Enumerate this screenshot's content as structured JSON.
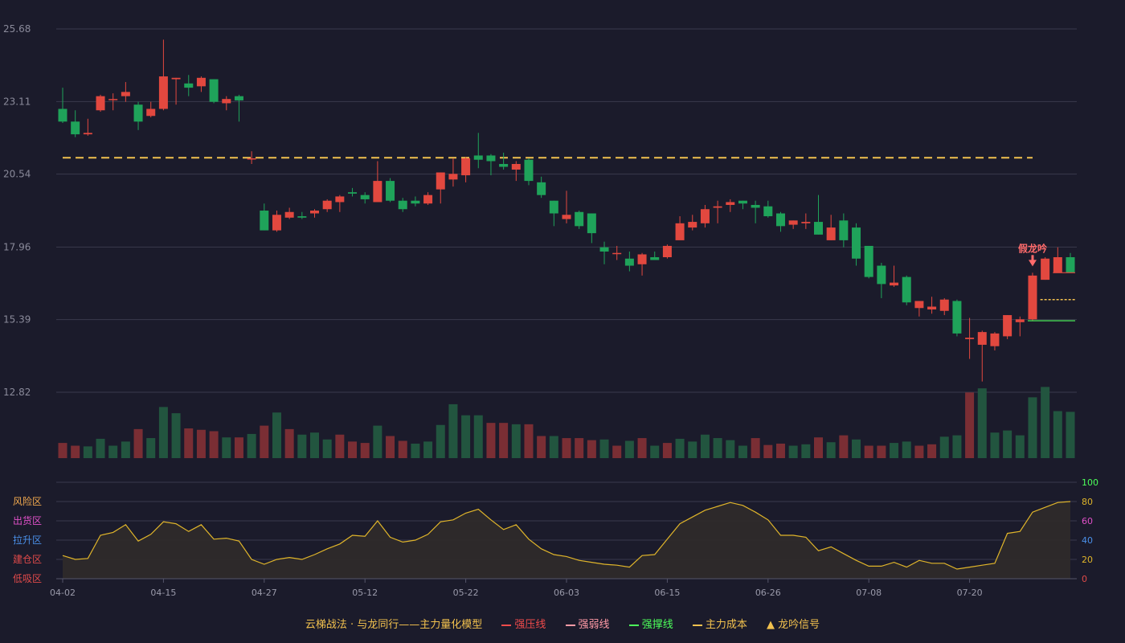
{
  "chart_data": {
    "type": "candlestick",
    "price_axis": {
      "ticks": [
        12.82,
        15.39,
        17.96,
        20.54,
        23.11,
        25.68
      ],
      "ylim": [
        12.82,
        25.68
      ]
    },
    "dates": [
      "04-02",
      "04-03",
      "04-07",
      "04-08",
      "04-09",
      "04-10",
      "04-11",
      "04-14",
      "04-15",
      "04-16",
      "04-17",
      "04-18",
      "04-21",
      "04-22",
      "04-23",
      "04-24",
      "04-25",
      "04-28",
      "04-29",
      "04-30",
      "05-06",
      "05-07",
      "05-08",
      "05-09",
      "05-12",
      "05-13",
      "05-14",
      "05-15",
      "05-16",
      "05-19",
      "05-20",
      "05-21",
      "05-22",
      "05-23",
      "05-26",
      "05-27",
      "05-28",
      "05-29",
      "05-30",
      "06-03",
      "06-04",
      "06-05",
      "06-06",
      "06-09",
      "06-10",
      "06-11",
      "06-12",
      "06-13",
      "06-16",
      "06-17",
      "06-18",
      "06-19",
      "06-20",
      "06-23",
      "06-24",
      "06-25",
      "06-26",
      "06-27",
      "06-30",
      "07-01",
      "07-02",
      "07-03",
      "07-04",
      "07-07",
      "07-08",
      "07-09",
      "07-10",
      "07-11",
      "07-14",
      "07-15",
      "07-16",
      "07-17",
      "07-18",
      "07-21",
      "07-22",
      "07-23",
      "07-24",
      "07-25",
      "07-28",
      "07-29",
      "07-30"
    ],
    "x_ticks": [
      "04-02",
      "04-15",
      "04-27",
      "05-12",
      "05-22",
      "06-03",
      "06-15",
      "06-26",
      "07-08",
      "07-20"
    ],
    "x_tick_index": [
      0,
      8,
      16,
      24,
      32,
      40,
      48,
      56,
      64,
      72
    ],
    "ohlc": [
      [
        22.85,
        22.4,
        23.6,
        22.35
      ],
      [
        22.4,
        21.95,
        22.8,
        21.85
      ],
      [
        21.95,
        22.0,
        22.5,
        21.9
      ],
      [
        22.8,
        23.3,
        23.35,
        22.75
      ],
      [
        23.2,
        23.2,
        23.4,
        22.8
      ],
      [
        23.3,
        23.45,
        23.8,
        23.1
      ],
      [
        23.0,
        22.4,
        23.1,
        22.1
      ],
      [
        22.6,
        22.85,
        23.1,
        22.55
      ],
      [
        22.85,
        24.0,
        25.3,
        22.8
      ],
      [
        23.9,
        23.95,
        23.95,
        23.0
      ],
      [
        23.75,
        23.6,
        24.05,
        23.3
      ],
      [
        23.65,
        23.95,
        24.0,
        23.45
      ],
      [
        23.9,
        23.1,
        23.9,
        23.05
      ],
      [
        23.05,
        23.2,
        23.3,
        22.8
      ],
      [
        23.3,
        23.15,
        23.35,
        22.4
      ],
      [
        21.1,
        21.1,
        21.35,
        20.9
      ],
      [
        19.25,
        18.55,
        19.5,
        18.55
      ],
      [
        18.55,
        19.1,
        19.25,
        18.5
      ],
      [
        19.0,
        19.2,
        19.35,
        18.95
      ],
      [
        19.05,
        19.0,
        19.2,
        18.95
      ],
      [
        19.15,
        19.25,
        19.3,
        19.0
      ],
      [
        19.3,
        19.6,
        19.65,
        19.2
      ],
      [
        19.55,
        19.75,
        19.8,
        19.2
      ],
      [
        19.9,
        19.85,
        20.05,
        19.75
      ],
      [
        19.8,
        19.65,
        19.9,
        19.5
      ],
      [
        19.55,
        20.3,
        21.0,
        19.6
      ],
      [
        20.3,
        19.6,
        20.4,
        19.55
      ],
      [
        19.6,
        19.3,
        19.7,
        19.2
      ],
      [
        19.6,
        19.5,
        19.75,
        19.4
      ],
      [
        19.5,
        19.8,
        19.9,
        19.45
      ],
      [
        20.0,
        20.6,
        20.6,
        19.5
      ],
      [
        20.35,
        20.55,
        21.1,
        20.1
      ],
      [
        20.5,
        21.1,
        21.15,
        20.25
      ],
      [
        21.2,
        21.05,
        22.0,
        20.75
      ],
      [
        21.2,
        21.0,
        21.25,
        20.5
      ],
      [
        20.9,
        20.8,
        21.3,
        20.7
      ],
      [
        20.7,
        20.9,
        21.0,
        20.3
      ],
      [
        21.05,
        20.3,
        21.1,
        20.15
      ],
      [
        20.25,
        19.8,
        20.45,
        19.7
      ],
      [
        19.6,
        19.15,
        19.6,
        18.7
      ],
      [
        18.95,
        19.1,
        19.95,
        18.8
      ],
      [
        19.2,
        18.7,
        19.25,
        18.6
      ],
      [
        19.15,
        18.45,
        19.15,
        18.1
      ],
      [
        17.95,
        17.8,
        18.15,
        17.35
      ],
      [
        17.75,
        17.75,
        18.0,
        17.5
      ],
      [
        17.55,
        17.3,
        17.8,
        17.1
      ],
      [
        17.35,
        17.7,
        17.75,
        16.95
      ],
      [
        17.6,
        17.5,
        17.8,
        17.55
      ],
      [
        17.6,
        18.0,
        18.05,
        17.55
      ],
      [
        18.2,
        18.8,
        19.05,
        18.25
      ],
      [
        18.65,
        18.85,
        19.1,
        18.55
      ],
      [
        18.8,
        19.3,
        19.45,
        18.65
      ],
      [
        19.35,
        19.4,
        19.6,
        18.8
      ],
      [
        19.45,
        19.55,
        19.65,
        19.2
      ],
      [
        19.6,
        19.5,
        19.6,
        19.3
      ],
      [
        19.45,
        19.35,
        19.6,
        18.8
      ],
      [
        19.4,
        19.05,
        19.6,
        19.0
      ],
      [
        19.15,
        18.7,
        19.2,
        18.5
      ],
      [
        18.75,
        18.9,
        18.9,
        18.6
      ],
      [
        18.8,
        18.85,
        19.15,
        18.6
      ],
      [
        18.85,
        18.4,
        19.8,
        18.4
      ],
      [
        18.2,
        18.65,
        19.1,
        18.2
      ],
      [
        18.9,
        18.2,
        19.15,
        17.95
      ],
      [
        18.65,
        17.55,
        18.8,
        17.3
      ],
      [
        18.0,
        16.9,
        18.0,
        16.85
      ],
      [
        17.3,
        16.65,
        17.4,
        16.15
      ],
      [
        16.6,
        16.7,
        17.3,
        16.55
      ],
      [
        16.9,
        16.0,
        16.95,
        15.9
      ],
      [
        15.8,
        16.05,
        16.05,
        15.5
      ],
      [
        15.75,
        15.85,
        16.2,
        15.6
      ],
      [
        15.7,
        16.1,
        16.15,
        15.55
      ],
      [
        16.05,
        14.9,
        16.1,
        14.8
      ],
      [
        14.7,
        14.75,
        15.45,
        14.0
      ],
      [
        14.5,
        14.95,
        15.0,
        13.2
      ],
      [
        14.45,
        14.9,
        14.95,
        14.3
      ],
      [
        14.8,
        15.55,
        15.55,
        14.7
      ],
      [
        15.3,
        15.4,
        15.5,
        14.8
      ],
      [
        15.4,
        16.95,
        17.05,
        15.35
      ],
      [
        16.8,
        17.55,
        17.6,
        16.8
      ],
      [
        17.05,
        17.6,
        17.95,
        17.05
      ],
      [
        17.6,
        17.05,
        17.75,
        17.05
      ]
    ],
    "volume_axis": {
      "ticks": [
        100
      ]
    },
    "volume": [
      22,
      18,
      17,
      28,
      18,
      24,
      42,
      29,
      74,
      65,
      43,
      41,
      39,
      30,
      30,
      35,
      47,
      66,
      42,
      34,
      37,
      27,
      34,
      24,
      22,
      47,
      32,
      25,
      21,
      24,
      48,
      78,
      62,
      62,
      51,
      51,
      49,
      49,
      32,
      32,
      29,
      29,
      26,
      27,
      18,
      25,
      29,
      18,
      22,
      28,
      24,
      34,
      29,
      26,
      18,
      29,
      19,
      21,
      18,
      20,
      30,
      23,
      33,
      27,
      18,
      18,
      22,
      24,
      18,
      20,
      31,
      33,
      95,
      101,
      37,
      40,
      33,
      88,
      103,
      68,
      67
    ],
    "volume_colors": [
      "red",
      "red",
      "green",
      "green",
      "green",
      "green",
      "red",
      "green",
      "green",
      "green",
      "red",
      "red",
      "red",
      "green",
      "red",
      "green",
      "red",
      "green",
      "red",
      "green",
      "green",
      "green",
      "red",
      "red",
      "red",
      "green",
      "red",
      "red",
      "green",
      "green",
      "green",
      "green",
      "green",
      "green",
      "red",
      "red",
      "green",
      "red",
      "red",
      "green",
      "red",
      "red",
      "red",
      "green",
      "red",
      "green",
      "red",
      "green",
      "red",
      "green",
      "green",
      "green",
      "green",
      "green",
      "green",
      "red",
      "red",
      "red",
      "green",
      "green",
      "red",
      "green",
      "red",
      "green",
      "red",
      "red",
      "green",
      "green",
      "red",
      "red",
      "green",
      "green",
      "red",
      "green",
      "green",
      "green",
      "green",
      "green",
      "green",
      "green",
      "green"
    ],
    "indicator_axis": {
      "ticks": [
        0,
        20,
        40,
        60,
        80,
        100
      ],
      "ylim": [
        0,
        100
      ]
    },
    "indicator": [
      24,
      20,
      21,
      45,
      48,
      56,
      39,
      46,
      59,
      57,
      49,
      56,
      41,
      42,
      39,
      20,
      15,
      20,
      22,
      20,
      25,
      31,
      36,
      45,
      44,
      60,
      43,
      38,
      40,
      46,
      59,
      61,
      68,
      72,
      61,
      51,
      56,
      41,
      31,
      25,
      23,
      19,
      17,
      15,
      14,
      12,
      24,
      25,
      41,
      57,
      64,
      71,
      75,
      79,
      76,
      69,
      61,
      45,
      45,
      43,
      29,
      33,
      26,
      19,
      13,
      13,
      17,
      12,
      19,
      16,
      16,
      10,
      12,
      14,
      16,
      47,
      49,
      69,
      74,
      79,
      80
    ],
    "signal": {
      "label": "假龙吟",
      "index": 77
    },
    "lines": {
      "main_cost_dashed": 21.12,
      "main_cost_short": 16.1,
      "strong_support": 15.35,
      "strong_pressure": 17.05
    },
    "zones": [
      "风险区",
      "出货区",
      "拉升区",
      "建仓区",
      "低吸区"
    ],
    "legend": [
      {
        "label": "云梯战法 · 与龙同行——主力量化模型",
        "kind": "title"
      },
      {
        "label": "强压线",
        "color": "#ef4b4b",
        "kind": "solid"
      },
      {
        "label": "强弱线",
        "color": "#ff9aa6",
        "kind": "dashed"
      },
      {
        "label": "强撑线",
        "color": "#4cff5a",
        "kind": "solid"
      },
      {
        "label": "主力成本",
        "color": "#f2c14e",
        "kind": "dashed"
      },
      {
        "label": "龙吟信号",
        "color": "#f2c14e",
        "kind": "triangle"
      }
    ]
  },
  "colors": {
    "bg": "#1b1b2b",
    "up": "#e2483f",
    "down": "#1fa35a",
    "grid": "#3a3a4c",
    "cost": "#f2c14e",
    "indicator": "#e0b52a",
    "zone_colors": [
      "#f2a94e",
      "#e050c8",
      "#4a8fe8",
      "#e04a4a",
      "#e04a4a"
    ],
    "indicator_tick_colors": [
      "#e04a4a",
      "#e0b52a",
      "#4a8fe8",
      "#e050c8",
      "#e0b52a",
      "#4cff5a"
    ]
  }
}
